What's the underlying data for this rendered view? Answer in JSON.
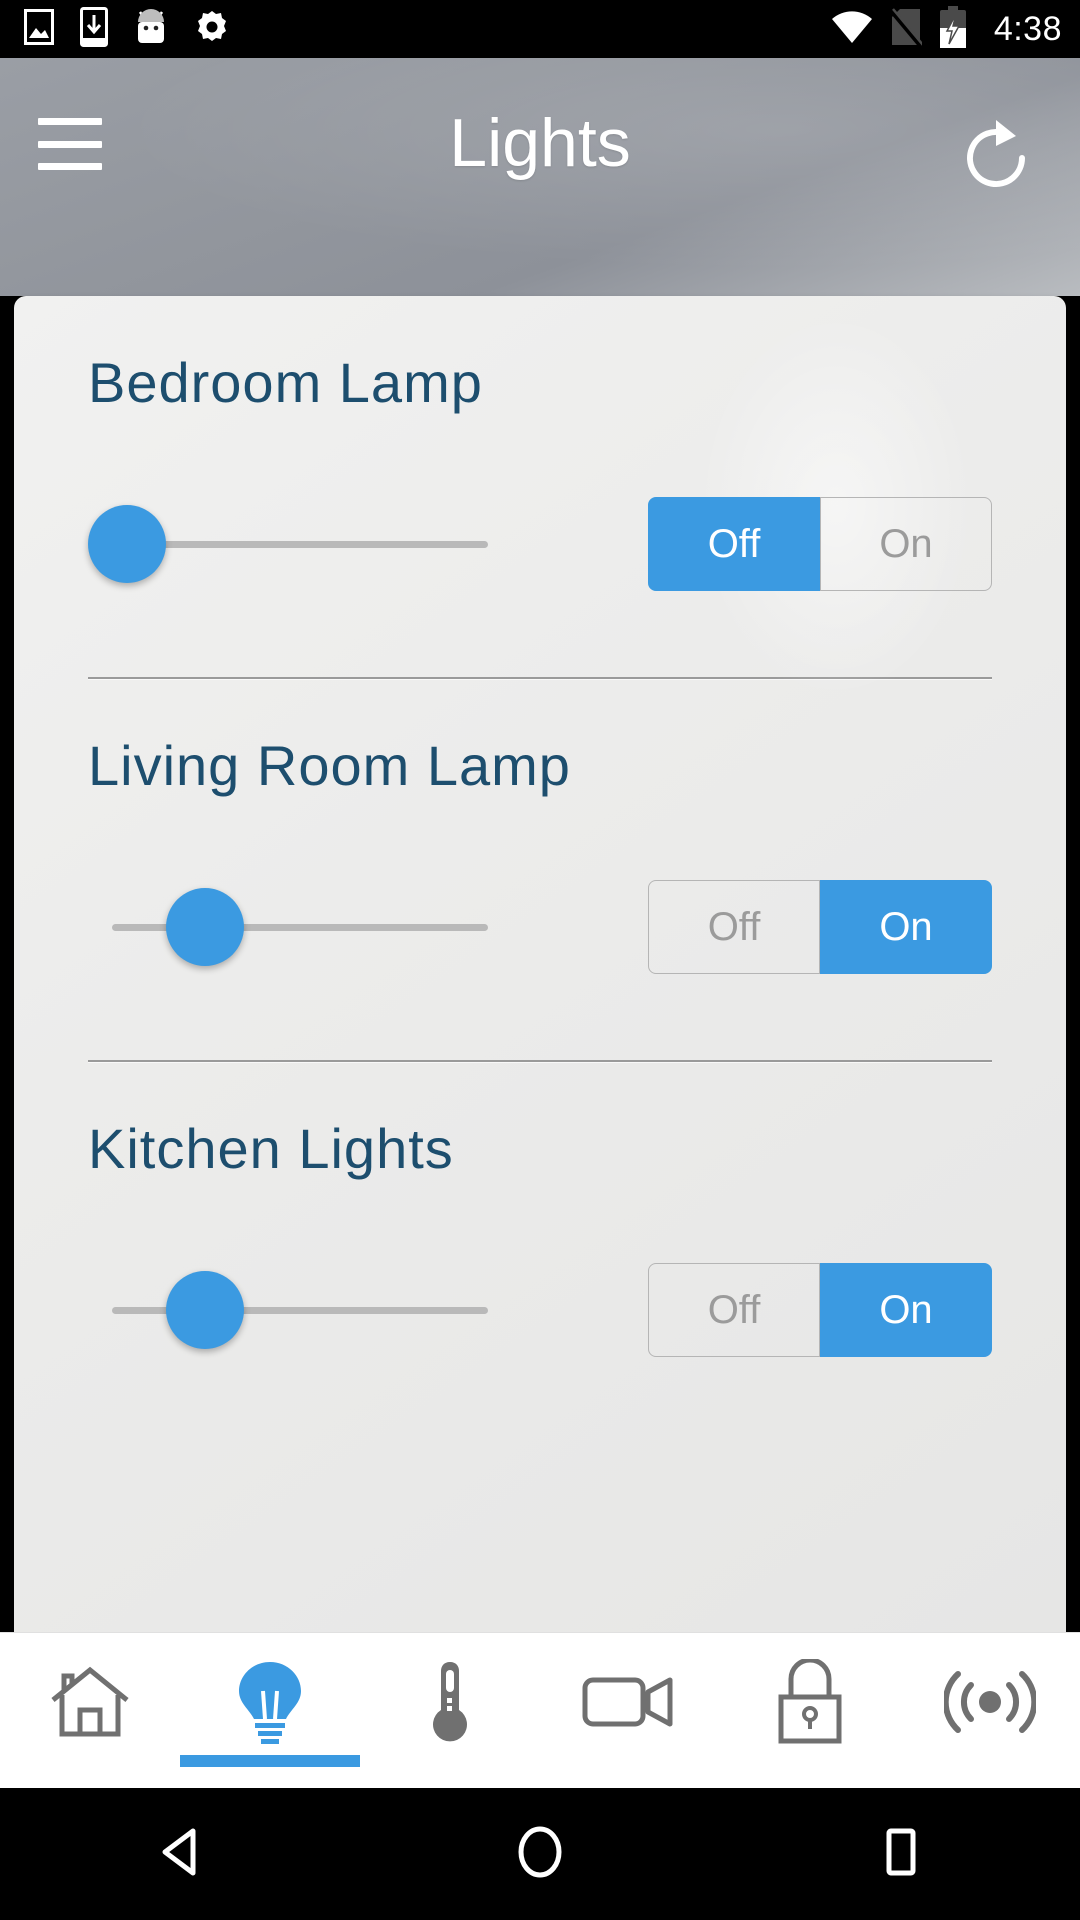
{
  "status_bar": {
    "time": "4:38",
    "left_icons": [
      "image-icon",
      "download-icon",
      "android-icon",
      "settings-gear-icon"
    ],
    "right_icons": [
      "wifi-icon",
      "no-sim-icon",
      "battery-charging-icon"
    ]
  },
  "app_bar": {
    "title": "Lights",
    "menu_icon": "hamburger-menu-icon",
    "refresh_icon": "refresh-icon"
  },
  "lights": [
    {
      "name": "Bedroom Lamp",
      "brightness": 0,
      "state": "Off",
      "off_label": "Off",
      "on_label": "On"
    },
    {
      "name": "Living Room Lamp",
      "brightness": 22,
      "state": "On",
      "off_label": "Off",
      "on_label": "On"
    },
    {
      "name": "Kitchen Lights",
      "brightness": 22,
      "state": "On",
      "off_label": "Off",
      "on_label": "On"
    }
  ],
  "bottom_nav": {
    "active_index": 1,
    "items": [
      {
        "icon": "home-icon",
        "label": "Home"
      },
      {
        "icon": "lightbulb-icon",
        "label": "Lights"
      },
      {
        "icon": "thermometer-icon",
        "label": "Climate"
      },
      {
        "icon": "camera-icon",
        "label": "Cameras"
      },
      {
        "icon": "lock-icon",
        "label": "Locks"
      },
      {
        "icon": "sensor-broadcast-icon",
        "label": "Sensors"
      }
    ]
  },
  "android_nav": {
    "back_icon": "back-triangle-icon",
    "home_icon": "home-circle-icon",
    "recents_icon": "recents-square-icon"
  },
  "colors": {
    "accent": "#3b9ae1",
    "title_text": "#1d4e6e",
    "card_bg": "#ededec",
    "inactive_text": "#9b9b9b"
  }
}
